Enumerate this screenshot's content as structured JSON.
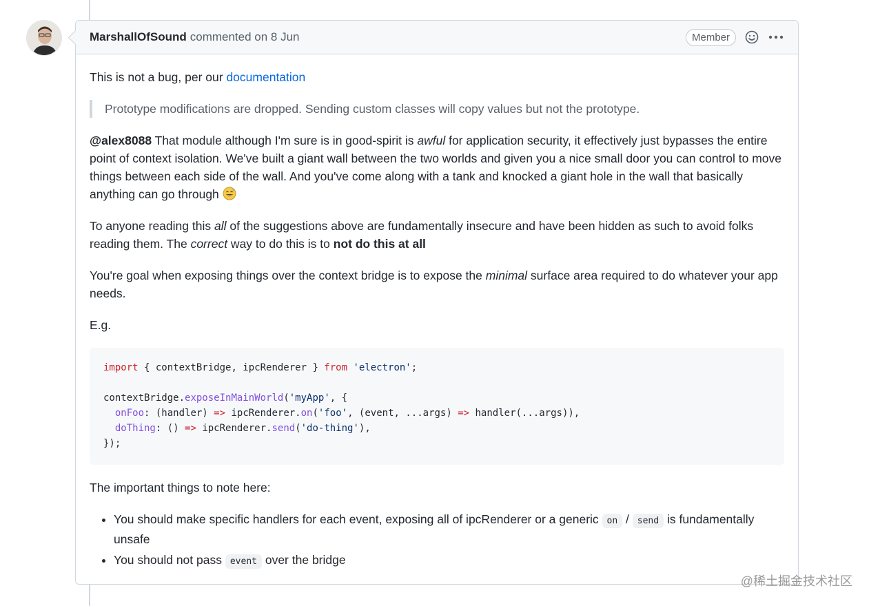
{
  "comment": {
    "author": "MarshallOfSound",
    "meta": "commented on 8 Jun",
    "badge": "Member"
  },
  "body": {
    "p1_text": "This is not a bug, per our ",
    "p1_link": "documentation",
    "quote": "Prototype modifications are dropped. Sending custom classes will copy values but not the prototype.",
    "p2_mention": "@alex8088",
    "p2_a": " That module although I'm sure is in good-spirit is ",
    "p2_em": "awful",
    "p2_b": " for application security, it effectively just bypasses the entire point of context isolation. We've built a giant wall between the two worlds and given you a nice small door you can control to move things between each side of the wall. And you've come along with a tank and knocked a giant hole in the wall that basically anything can go through ",
    "p3_a": "To anyone reading this ",
    "p3_em1": "all",
    "p3_b": " of the suggestions above are fundamentally insecure and have been hidden as such to avoid folks reading them. The ",
    "p3_em2": "correct",
    "p3_c": " way to do this is to ",
    "p3_strong": "not do this at all",
    "p4_a": "You're goal when exposing things over the context bridge is to expose the ",
    "p4_em": "minimal",
    "p4_b": " surface area required to do whatever your app needs.",
    "p5": "E.g.",
    "code": {
      "l1_import": "import",
      "l1_mid": " { contextBridge, ipcRenderer } ",
      "l1_from": "from",
      "l1_sp": " ",
      "l1_str": "'electron'",
      "l1_end": ";",
      "l3_a": "contextBridge.",
      "l3_fn": "exposeInMainWorld",
      "l3_b": "(",
      "l3_str": "'myApp'",
      "l3_c": ", {",
      "l4_indent": "  ",
      "l4_prop": "onFoo",
      "l4_a": ": (handler) ",
      "l4_arrow": "=>",
      "l4_b": " ipcRenderer.",
      "l4_fn": "on",
      "l4_c": "(",
      "l4_str": "'foo'",
      "l4_d": ", (event, ...args) ",
      "l4_arrow2": "=>",
      "l4_e": " handler(...args)),",
      "l5_indent": "  ",
      "l5_prop": "doThing",
      "l5_a": ": () ",
      "l5_arrow": "=>",
      "l5_b": " ipcRenderer.",
      "l5_fn": "send",
      "l5_c": "(",
      "l5_str": "'do-thing'",
      "l5_d": "),",
      "l6": "});"
    },
    "p6": "The important things to note here:",
    "li1_a": "You should make specific handlers for each event, exposing all of ipcRenderer or a generic ",
    "li1_code1": "on",
    "li1_sep": " / ",
    "li1_code2": "send",
    "li1_b": " is fundamentally unsafe",
    "li2_a": "You should not pass ",
    "li2_code": "event",
    "li2_b": " over the bridge"
  },
  "watermark": "@稀土掘金技术社区",
  "icons": {
    "avatar": "avatar",
    "reaction": "smiley-icon",
    "menu": "kebab-horizontal-icon",
    "emoji": "grinning-sweat-emoji"
  }
}
